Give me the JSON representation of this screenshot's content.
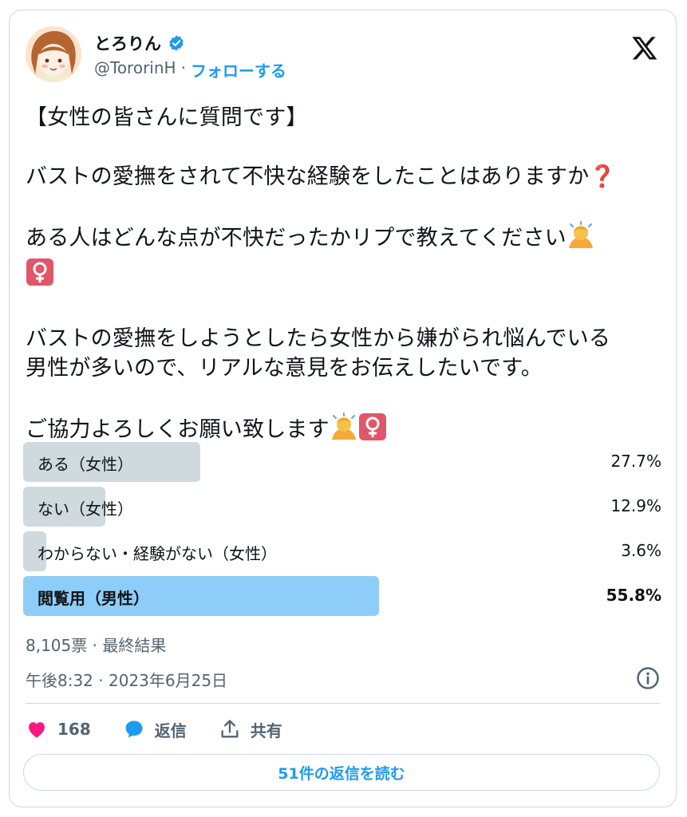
{
  "author": {
    "display_name": "とろりん",
    "handle": "@TororinH",
    "separator": "·",
    "follow_label": "フォローする"
  },
  "tweet": {
    "line1": "【女性の皆さんに質問です】",
    "line2": "バストの愛撫をされて不快な経験をしたことはありますか",
    "line3": "ある人はどんな点が不快だったかリプで教えてください",
    "line4a": "バストの愛撫をしようとしたら女性から嫌がられ悩んでいる",
    "line4b": "男性が多いので、リアルな意見をお伝えしたいです。",
    "line5": "ご協力よろしくお願い致します",
    "emoji_question": "❓",
    "emoji_female": "♀"
  },
  "poll": {
    "options": [
      {
        "label": "ある（女性）",
        "percent": "27.7%",
        "value": 27.7,
        "winner": false
      },
      {
        "label": "ない（女性）",
        "percent": "12.9%",
        "value": 12.9,
        "winner": false
      },
      {
        "label": "わからない・経験がない（女性）",
        "percent": "3.6%",
        "value": 3.6,
        "winner": false
      },
      {
        "label": "閲覧用（男性）",
        "percent": "55.8%",
        "value": 55.8,
        "winner": true
      }
    ],
    "votes_text": "8,105票 · 最終結果"
  },
  "timestamp": "午後8:32 · 2023年6月25日",
  "actions": {
    "like_count": "168",
    "reply_label": "返信",
    "share_label": "共有"
  },
  "read_replies_label": "51件の返信を読む",
  "colors": {
    "accent": "#1d9bf0",
    "poll_bar": "#cfd9de",
    "poll_winner": "#8ecdf7",
    "like": "#f91880"
  }
}
